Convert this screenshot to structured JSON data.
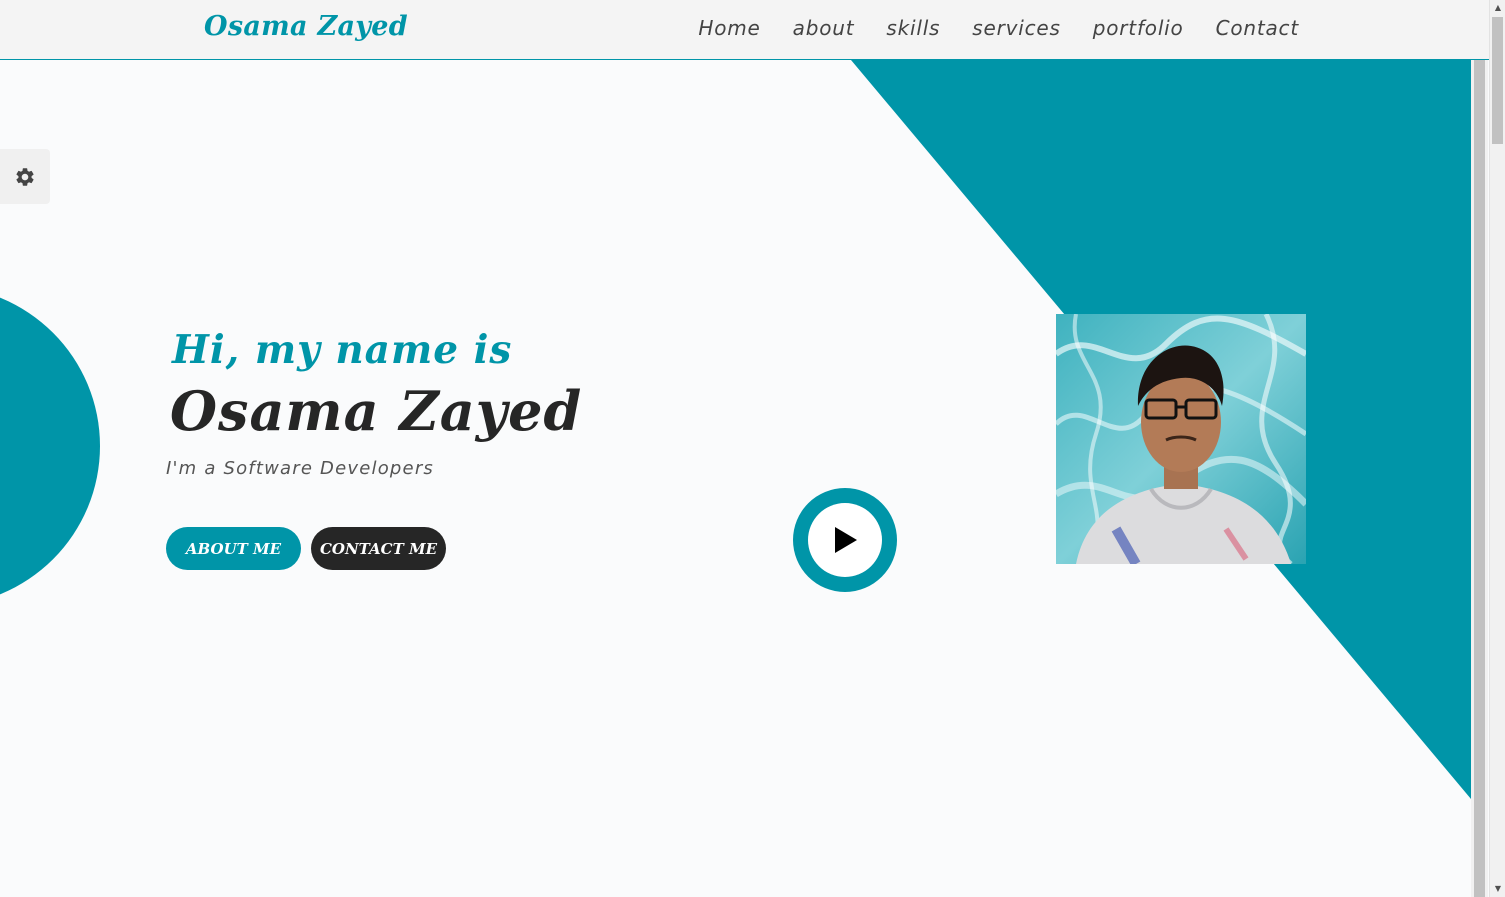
{
  "brand": {
    "name": "Osama Zayed"
  },
  "nav": {
    "items": [
      {
        "label": "Home"
      },
      {
        "label": "about"
      },
      {
        "label": "skills"
      },
      {
        "label": "services"
      },
      {
        "label": "portfolio"
      },
      {
        "label": "Contact"
      }
    ]
  },
  "hero": {
    "greeting": "Hi, my name is",
    "name": "Osama Zayed",
    "role": "I'm a Software Developers",
    "about_button": "ABOUT ME",
    "contact_button": "CONTACT ME"
  },
  "settings": {
    "icon": "gear-icon"
  },
  "play": {
    "icon": "play-icon"
  },
  "colors": {
    "accent": "#0095a8",
    "dark": "#262626",
    "background": "#fafbfc",
    "nav_background": "#f4f4f4"
  }
}
